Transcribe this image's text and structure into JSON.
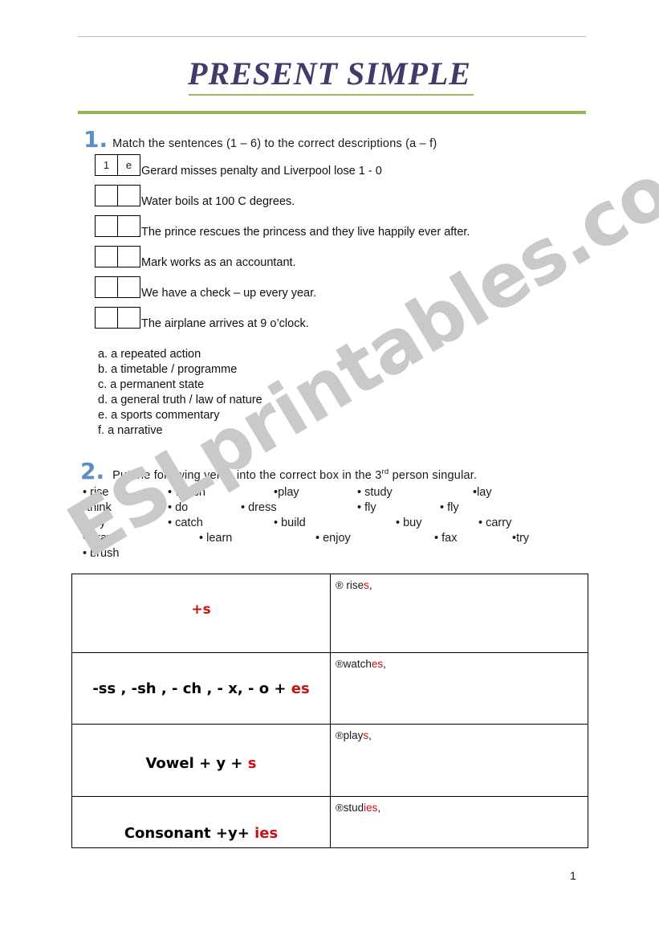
{
  "document": {
    "title": "PRESENT SIMPLE",
    "page_number": "1",
    "watermark": "ESLprintables.com",
    "colors": {
      "title": "#423a6b",
      "green_rule": "#94b558",
      "number_blue": "#5b8ec4",
      "accent_red": "#cc1111",
      "top_rule": "#b8bcc6",
      "watermark": "#c9c9c9"
    }
  },
  "exercise1": {
    "number": "1.",
    "instruction": "Match the sentences (1 – 6) to the correct descriptions  (a – f)",
    "items": [
      {
        "box_left": "1",
        "box_right": "e",
        "sentence": "Gerard misses penalty and Liverpool lose 1 - 0"
      },
      {
        "box_left": "",
        "box_right": "",
        "sentence": "Water boils at 100 C degrees."
      },
      {
        "box_left": "",
        "box_right": "",
        "sentence": "The prince rescues the princess and they live happily ever after."
      },
      {
        "box_left": "",
        "box_right": "",
        "sentence": "Mark works as an accountant."
      },
      {
        "box_left": "",
        "box_right": "",
        "sentence": "We have a check – up every year."
      },
      {
        "box_left": "",
        "box_right": "",
        "sentence": "The airplane arrives at 9 o’clock."
      }
    ],
    "descriptions": [
      "a. a repeated action",
      "b. a timetable  / programme",
      "c. a permanent state",
      "d. a general truth / law of nature",
      "e. a sports commentary",
      "f. a narrative"
    ]
  },
  "exercise2": {
    "number": "2.",
    "instruction_before": "Put the following verbs into the correct box in the 3",
    "instruction_sup": "rd",
    "instruction_after": " person singular.",
    "verb_rows": [
      [
        "rise",
        "watch",
        "play",
        "study",
        "lay"
      ],
      [
        "think",
        "do",
        "dress",
        "fly",
        "fly"
      ],
      [
        "pay",
        "catch",
        "build",
        "buy",
        "carry"
      ],
      [
        "draw",
        "learn",
        "enjoy",
        "fax",
        "try"
      ],
      [
        "brush"
      ]
    ],
    "table": {
      "rows": [
        {
          "rule_plain": "+",
          "rule_red": "s",
          "example_prefix": " rise",
          "example_suffix": "s",
          "example_tail": ","
        },
        {
          "rule_plain": "-ss , -sh , - ch , - x, - o + ",
          "rule_red": "es",
          "example_prefix": "watch",
          "example_suffix": "es",
          "example_tail": ","
        },
        {
          "rule_plain": "Vowel + y + ",
          "rule_red": "s",
          "example_prefix": "play",
          "example_suffix": "s",
          "example_tail": ","
        },
        {
          "rule_plain": "Consonant +y+ ",
          "rule_red": "ies",
          "example_prefix": "stud",
          "example_suffix": "ies",
          "example_tail": ","
        }
      ]
    }
  }
}
